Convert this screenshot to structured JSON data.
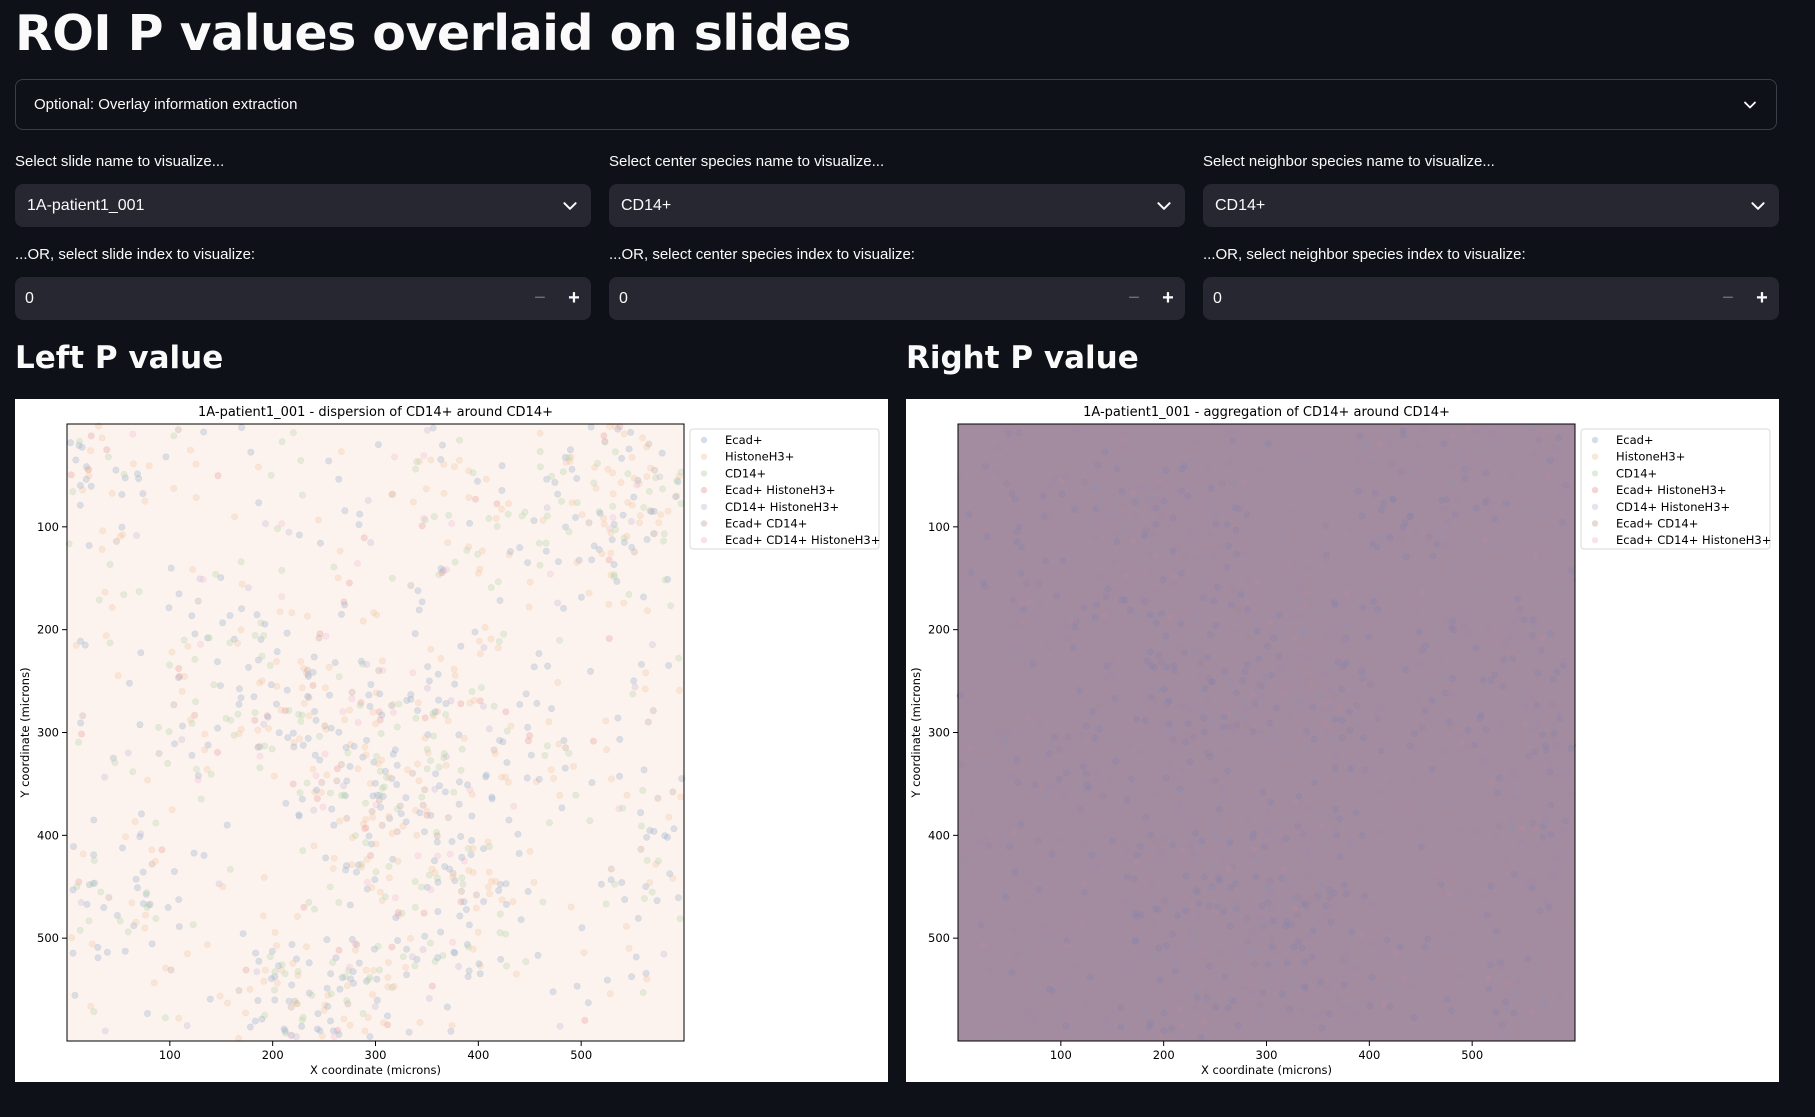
{
  "page": {
    "title": "ROI P values overlaid on slides"
  },
  "expander": {
    "label": "Optional: Overlay information extraction"
  },
  "controls": {
    "slide_select": {
      "label": "Select slide name to visualize...",
      "value": "1A-patient1_001"
    },
    "center_select": {
      "label": "Select center species name to visualize...",
      "value": "CD14+"
    },
    "neighbor_select": {
      "label": "Select neighbor species name to visualize...",
      "value": "CD14+"
    },
    "slide_index": {
      "label": "...OR, select slide index to visualize:",
      "value": "0"
    },
    "center_index": {
      "label": "...OR, select center species index to visualize:",
      "value": "0"
    },
    "neighbor_index": {
      "label": "...OR, select neighbor species index to visualize:",
      "value": "0"
    },
    "minus_symbol": "−",
    "plus_symbol": "+"
  },
  "sections": {
    "left": "Left P value",
    "right": "Right P value"
  },
  "chart_data": [
    {
      "type": "scatter",
      "title": "1A-patient1_001 - dispersion of CD14+ around CD14+",
      "xlabel": "X coordinate (microns)",
      "ylabel": "Y coordinate (microns)",
      "xlim": [
        0,
        600
      ],
      "ylim": [
        600,
        0
      ],
      "xticks": [
        100,
        200,
        300,
        400,
        500
      ],
      "yticks": [
        100,
        200,
        300,
        400,
        500
      ],
      "background_color": "#fdf3ee",
      "legend_location": "upper-right-outside",
      "series": [
        {
          "name": "Ecad+",
          "color": "#9fb5cf"
        },
        {
          "name": "HistoneH3+",
          "color": "#f2c9a6"
        },
        {
          "name": "CD14+",
          "color": "#b6d6ae"
        },
        {
          "name": "Ecad+ HistoneH3+",
          "color": "#e8a0a0"
        },
        {
          "name": "CD14+ HistoneH3+",
          "color": "#c8bedb"
        },
        {
          "name": "Ecad+ CD14+",
          "color": "#c7aea5"
        },
        {
          "name": "Ecad+ CD14+ HistoneH3+",
          "color": "#f2bfd8"
        }
      ]
    },
    {
      "type": "scatter",
      "title": "1A-patient1_001 - aggregation of CD14+ around CD14+",
      "xlabel": "X coordinate (microns)",
      "ylabel": "Y coordinate (microns)",
      "xlim": [
        0,
        600
      ],
      "ylim": [
        600,
        0
      ],
      "xticks": [
        100,
        200,
        300,
        400,
        500
      ],
      "yticks": [
        100,
        200,
        300,
        400,
        500
      ],
      "background_color": "#a48ca0",
      "legend_location": "upper-right-outside",
      "series": [
        {
          "name": "Ecad+",
          "color": "#9fb5cf"
        },
        {
          "name": "HistoneH3+",
          "color": "#f2c9a6"
        },
        {
          "name": "CD14+",
          "color": "#b6d6ae"
        },
        {
          "name": "Ecad+ HistoneH3+",
          "color": "#e8a0a0"
        },
        {
          "name": "CD14+ HistoneH3+",
          "color": "#c8bedb"
        },
        {
          "name": "Ecad+ CD14+",
          "color": "#c7aea5"
        },
        {
          "name": "Ecad+ CD14+ HistoneH3+",
          "color": "#f2bfd8"
        }
      ]
    }
  ]
}
